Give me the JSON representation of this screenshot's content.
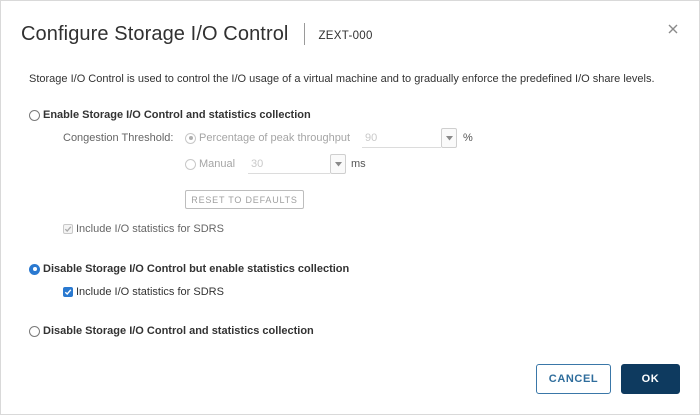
{
  "dialog": {
    "title": "Configure Storage I/O Control",
    "subtitle": "ZEXT-000",
    "description": "Storage I/O Control is used to control the I/O usage of a virtual machine and to gradually enforce the predefined I/O share levels."
  },
  "options": {
    "enable": {
      "label": "Enable Storage I/O Control and statistics collection",
      "selected": false,
      "congestion_label": "Congestion Threshold:",
      "percentage": {
        "label": "Percentage of peak throughput",
        "value": "90",
        "unit": "%",
        "selected": true,
        "disabled": true
      },
      "manual": {
        "label": "Manual",
        "value": "30",
        "unit": "ms",
        "selected": false,
        "disabled": true
      },
      "reset_label": "RESET TO DEFAULTS",
      "include_stats": {
        "label": "Include I/O statistics for SDRS",
        "checked": true,
        "disabled": true
      }
    },
    "disable_with_stats": {
      "label": "Disable Storage I/O Control but enable statistics collection",
      "selected": true,
      "include_stats": {
        "label": "Include I/O statistics for SDRS",
        "checked": true,
        "disabled": false
      }
    },
    "disable_all": {
      "label": "Disable Storage I/O Control and statistics collection",
      "selected": false
    }
  },
  "footer": {
    "cancel_label": "CANCEL",
    "ok_label": "OK"
  },
  "icons": {
    "close": "close-icon",
    "dropdown": "chevron-down-icon",
    "check": "checkmark-icon"
  },
  "colors": {
    "accent": "#2a79d0",
    "primary_button": "#0e3a5f",
    "cancel_border": "#3a77a8"
  }
}
